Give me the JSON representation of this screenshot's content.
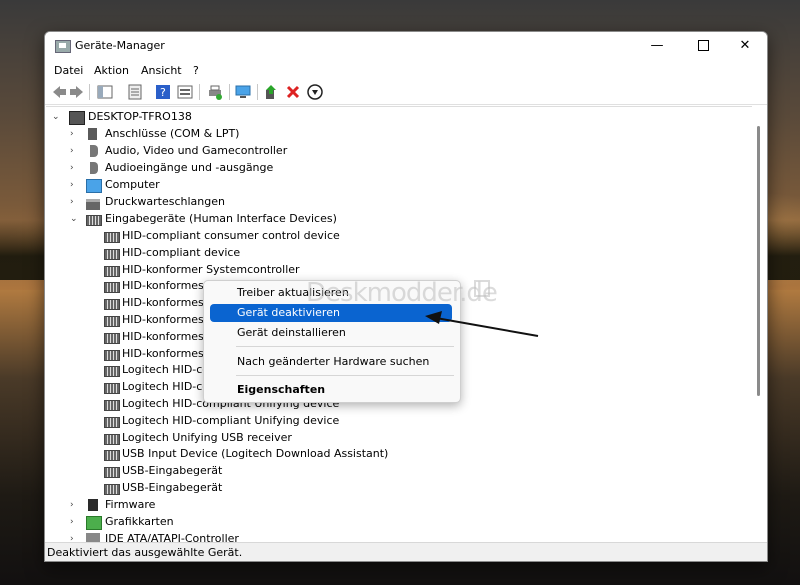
{
  "window": {
    "title": "Geräte-Manager",
    "controls": {
      "minimize": "—",
      "close": "✕"
    }
  },
  "menu": [
    "Datei",
    "Aktion",
    "Ansicht",
    "?"
  ],
  "tree": {
    "root": "DESKTOP-TFRO138",
    "categories": [
      "Anschlüsse (COM & LPT)",
      "Audio, Video und Gamecontroller",
      "Audioeingänge und -ausgänge",
      "Computer",
      "Druckwarteschlangen",
      "Eingabegeräte (Human Interface Devices)"
    ],
    "hid_devices": [
      "HID-compliant consumer control device",
      "HID-compliant device",
      "HID-konformer Systemcontroller",
      "HID-konformes B",
      "HID-konformes",
      "HID-konformes,",
      "HID-konformes,",
      "HID-konformes,",
      "Logitech HID-co",
      "Logitech HID-co",
      "Logitech HID-compliant Unifying device",
      "Logitech HID-compliant Unifying device",
      "Logitech Unifying USB receiver",
      "USB Input Device (Logitech Download Assistant)",
      "USB-Eingabegerät",
      "USB-Eingabegerät"
    ],
    "after": [
      "Firmware",
      "Grafikkarten",
      "IDE ATA/ATAPI-Controller"
    ]
  },
  "context_menu": {
    "update": "Treiber aktualisieren",
    "disable": "Gerät deaktivieren",
    "uninstall": "Gerät deinstallieren",
    "scan": "Nach geänderter Hardware suchen",
    "properties": "Eigenschaften"
  },
  "status": "Deaktiviert das ausgewählte Gerät.",
  "watermark": "Deskmodder.de",
  "colors": {
    "highlight": "#0a64d0",
    "arrow": "#111111"
  }
}
